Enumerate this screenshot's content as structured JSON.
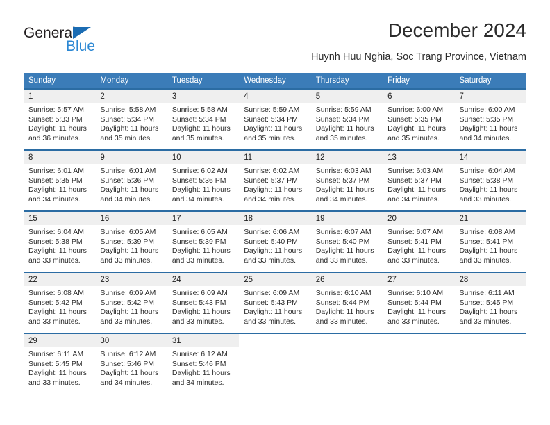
{
  "brand": {
    "name_top": "General",
    "name_bottom": "Blue",
    "accent_color": "#2b87d3",
    "triangle_color": "#1b6cb3"
  },
  "header": {
    "title": "December 2024",
    "subtitle": "Huynh Huu Nghia, Soc Trang Province, Vietnam"
  },
  "calendar": {
    "header_bg": "#3b7cb8",
    "row_border_color": "#2b6ca3",
    "daynum_bg": "#efefef",
    "weekdays": [
      "Sunday",
      "Monday",
      "Tuesday",
      "Wednesday",
      "Thursday",
      "Friday",
      "Saturday"
    ],
    "weeks": [
      [
        {
          "day": "1",
          "sunrise": "Sunrise: 5:57 AM",
          "sunset": "Sunset: 5:33 PM",
          "daylight_1": "Daylight: 11 hours",
          "daylight_2": "and 36 minutes."
        },
        {
          "day": "2",
          "sunrise": "Sunrise: 5:58 AM",
          "sunset": "Sunset: 5:34 PM",
          "daylight_1": "Daylight: 11 hours",
          "daylight_2": "and 35 minutes."
        },
        {
          "day": "3",
          "sunrise": "Sunrise: 5:58 AM",
          "sunset": "Sunset: 5:34 PM",
          "daylight_1": "Daylight: 11 hours",
          "daylight_2": "and 35 minutes."
        },
        {
          "day": "4",
          "sunrise": "Sunrise: 5:59 AM",
          "sunset": "Sunset: 5:34 PM",
          "daylight_1": "Daylight: 11 hours",
          "daylight_2": "and 35 minutes."
        },
        {
          "day": "5",
          "sunrise": "Sunrise: 5:59 AM",
          "sunset": "Sunset: 5:34 PM",
          "daylight_1": "Daylight: 11 hours",
          "daylight_2": "and 35 minutes."
        },
        {
          "day": "6",
          "sunrise": "Sunrise: 6:00 AM",
          "sunset": "Sunset: 5:35 PM",
          "daylight_1": "Daylight: 11 hours",
          "daylight_2": "and 35 minutes."
        },
        {
          "day": "7",
          "sunrise": "Sunrise: 6:00 AM",
          "sunset": "Sunset: 5:35 PM",
          "daylight_1": "Daylight: 11 hours",
          "daylight_2": "and 34 minutes."
        }
      ],
      [
        {
          "day": "8",
          "sunrise": "Sunrise: 6:01 AM",
          "sunset": "Sunset: 5:35 PM",
          "daylight_1": "Daylight: 11 hours",
          "daylight_2": "and 34 minutes."
        },
        {
          "day": "9",
          "sunrise": "Sunrise: 6:01 AM",
          "sunset": "Sunset: 5:36 PM",
          "daylight_1": "Daylight: 11 hours",
          "daylight_2": "and 34 minutes."
        },
        {
          "day": "10",
          "sunrise": "Sunrise: 6:02 AM",
          "sunset": "Sunset: 5:36 PM",
          "daylight_1": "Daylight: 11 hours",
          "daylight_2": "and 34 minutes."
        },
        {
          "day": "11",
          "sunrise": "Sunrise: 6:02 AM",
          "sunset": "Sunset: 5:37 PM",
          "daylight_1": "Daylight: 11 hours",
          "daylight_2": "and 34 minutes."
        },
        {
          "day": "12",
          "sunrise": "Sunrise: 6:03 AM",
          "sunset": "Sunset: 5:37 PM",
          "daylight_1": "Daylight: 11 hours",
          "daylight_2": "and 34 minutes."
        },
        {
          "day": "13",
          "sunrise": "Sunrise: 6:03 AM",
          "sunset": "Sunset: 5:37 PM",
          "daylight_1": "Daylight: 11 hours",
          "daylight_2": "and 34 minutes."
        },
        {
          "day": "14",
          "sunrise": "Sunrise: 6:04 AM",
          "sunset": "Sunset: 5:38 PM",
          "daylight_1": "Daylight: 11 hours",
          "daylight_2": "and 33 minutes."
        }
      ],
      [
        {
          "day": "15",
          "sunrise": "Sunrise: 6:04 AM",
          "sunset": "Sunset: 5:38 PM",
          "daylight_1": "Daylight: 11 hours",
          "daylight_2": "and 33 minutes."
        },
        {
          "day": "16",
          "sunrise": "Sunrise: 6:05 AM",
          "sunset": "Sunset: 5:39 PM",
          "daylight_1": "Daylight: 11 hours",
          "daylight_2": "and 33 minutes."
        },
        {
          "day": "17",
          "sunrise": "Sunrise: 6:05 AM",
          "sunset": "Sunset: 5:39 PM",
          "daylight_1": "Daylight: 11 hours",
          "daylight_2": "and 33 minutes."
        },
        {
          "day": "18",
          "sunrise": "Sunrise: 6:06 AM",
          "sunset": "Sunset: 5:40 PM",
          "daylight_1": "Daylight: 11 hours",
          "daylight_2": "and 33 minutes."
        },
        {
          "day": "19",
          "sunrise": "Sunrise: 6:07 AM",
          "sunset": "Sunset: 5:40 PM",
          "daylight_1": "Daylight: 11 hours",
          "daylight_2": "and 33 minutes."
        },
        {
          "day": "20",
          "sunrise": "Sunrise: 6:07 AM",
          "sunset": "Sunset: 5:41 PM",
          "daylight_1": "Daylight: 11 hours",
          "daylight_2": "and 33 minutes."
        },
        {
          "day": "21",
          "sunrise": "Sunrise: 6:08 AM",
          "sunset": "Sunset: 5:41 PM",
          "daylight_1": "Daylight: 11 hours",
          "daylight_2": "and 33 minutes."
        }
      ],
      [
        {
          "day": "22",
          "sunrise": "Sunrise: 6:08 AM",
          "sunset": "Sunset: 5:42 PM",
          "daylight_1": "Daylight: 11 hours",
          "daylight_2": "and 33 minutes."
        },
        {
          "day": "23",
          "sunrise": "Sunrise: 6:09 AM",
          "sunset": "Sunset: 5:42 PM",
          "daylight_1": "Daylight: 11 hours",
          "daylight_2": "and 33 minutes."
        },
        {
          "day": "24",
          "sunrise": "Sunrise: 6:09 AM",
          "sunset": "Sunset: 5:43 PM",
          "daylight_1": "Daylight: 11 hours",
          "daylight_2": "and 33 minutes."
        },
        {
          "day": "25",
          "sunrise": "Sunrise: 6:09 AM",
          "sunset": "Sunset: 5:43 PM",
          "daylight_1": "Daylight: 11 hours",
          "daylight_2": "and 33 minutes."
        },
        {
          "day": "26",
          "sunrise": "Sunrise: 6:10 AM",
          "sunset": "Sunset: 5:44 PM",
          "daylight_1": "Daylight: 11 hours",
          "daylight_2": "and 33 minutes."
        },
        {
          "day": "27",
          "sunrise": "Sunrise: 6:10 AM",
          "sunset": "Sunset: 5:44 PM",
          "daylight_1": "Daylight: 11 hours",
          "daylight_2": "and 33 minutes."
        },
        {
          "day": "28",
          "sunrise": "Sunrise: 6:11 AM",
          "sunset": "Sunset: 5:45 PM",
          "daylight_1": "Daylight: 11 hours",
          "daylight_2": "and 33 minutes."
        }
      ],
      [
        {
          "day": "29",
          "sunrise": "Sunrise: 6:11 AM",
          "sunset": "Sunset: 5:45 PM",
          "daylight_1": "Daylight: 11 hours",
          "daylight_2": "and 33 minutes."
        },
        {
          "day": "30",
          "sunrise": "Sunrise: 6:12 AM",
          "sunset": "Sunset: 5:46 PM",
          "daylight_1": "Daylight: 11 hours",
          "daylight_2": "and 34 minutes."
        },
        {
          "day": "31",
          "sunrise": "Sunrise: 6:12 AM",
          "sunset": "Sunset: 5:46 PM",
          "daylight_1": "Daylight: 11 hours",
          "daylight_2": "and 34 minutes."
        },
        {
          "day": "",
          "sunrise": "",
          "sunset": "",
          "daylight_1": "",
          "daylight_2": ""
        },
        {
          "day": "",
          "sunrise": "",
          "sunset": "",
          "daylight_1": "",
          "daylight_2": ""
        },
        {
          "day": "",
          "sunrise": "",
          "sunset": "",
          "daylight_1": "",
          "daylight_2": ""
        },
        {
          "day": "",
          "sunrise": "",
          "sunset": "",
          "daylight_1": "",
          "daylight_2": ""
        }
      ]
    ]
  }
}
